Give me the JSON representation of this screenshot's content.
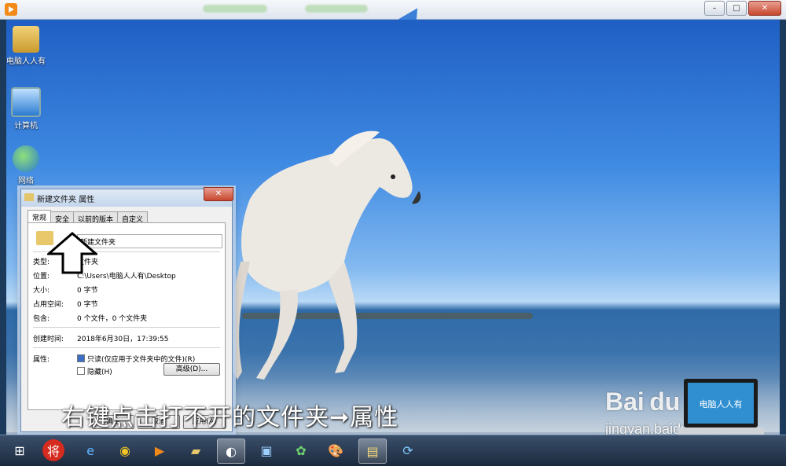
{
  "player": {
    "minimize_glyph": "–",
    "maximize_glyph": "□",
    "close_glyph": "✕"
  },
  "desktop_icons": [
    {
      "label": "电脑人人有",
      "icon": "user-folder-icon"
    },
    {
      "label": "计算机",
      "icon": "computer-icon"
    },
    {
      "label": "网络",
      "icon": "network-icon"
    }
  ],
  "dialog": {
    "title": "新建文件夹 属性",
    "close_glyph": "✕",
    "tabs": [
      "常规",
      "安全",
      "以前的版本",
      "自定义"
    ],
    "name_value": "新建文件夹",
    "rows": [
      {
        "key": "类型:",
        "value": "文件夹"
      },
      {
        "key": "位置:",
        "value": "C:\\Users\\电脑人人有\\Desktop"
      },
      {
        "key": "大小:",
        "value": "0 字节"
      },
      {
        "key": "占用空间:",
        "value": "0 字节"
      },
      {
        "key": "包含:",
        "value": "0 个文件，0 个文件夹"
      },
      {
        "key": "创建时间:",
        "value": "2018年6月30日，17:39:55"
      }
    ],
    "attributes_label": "属性:",
    "readonly_label": "只读(仅应用于文件夹中的文件)(R)",
    "hidden_label": "隐藏(H)",
    "advanced_label": "高级(D)...",
    "ok_label": "确定",
    "cancel_label": "取消",
    "apply_label": "应用(A)"
  },
  "caption": "右键点击打不开的文件夹➞属性",
  "watermark": {
    "logo": "Bai du 经验",
    "url": "jingyan.baidu.com",
    "laptop_text": "电脑人人有"
  },
  "taskbar": {
    "items": [
      {
        "icon": "start-orb-icon",
        "glyph": "⊞"
      },
      {
        "icon": "jiang-app-icon",
        "glyph": "将"
      },
      {
        "icon": "internet-explorer-icon",
        "glyph": "e"
      },
      {
        "icon": "chrome-icon",
        "glyph": "◉"
      },
      {
        "icon": "media-player-icon",
        "glyph": "▶"
      },
      {
        "icon": "folder-app-icon",
        "glyph": "▰"
      },
      {
        "icon": "browser-app-icon",
        "glyph": "◐"
      },
      {
        "icon": "remote-desktop-icon",
        "glyph": "▣"
      },
      {
        "icon": "pinwheel-icon",
        "glyph": "✿"
      },
      {
        "icon": "paint-icon",
        "glyph": "🎨"
      },
      {
        "icon": "explorer-icon",
        "glyph": "▤"
      },
      {
        "icon": "sync-app-icon",
        "glyph": "⟳"
      }
    ]
  }
}
